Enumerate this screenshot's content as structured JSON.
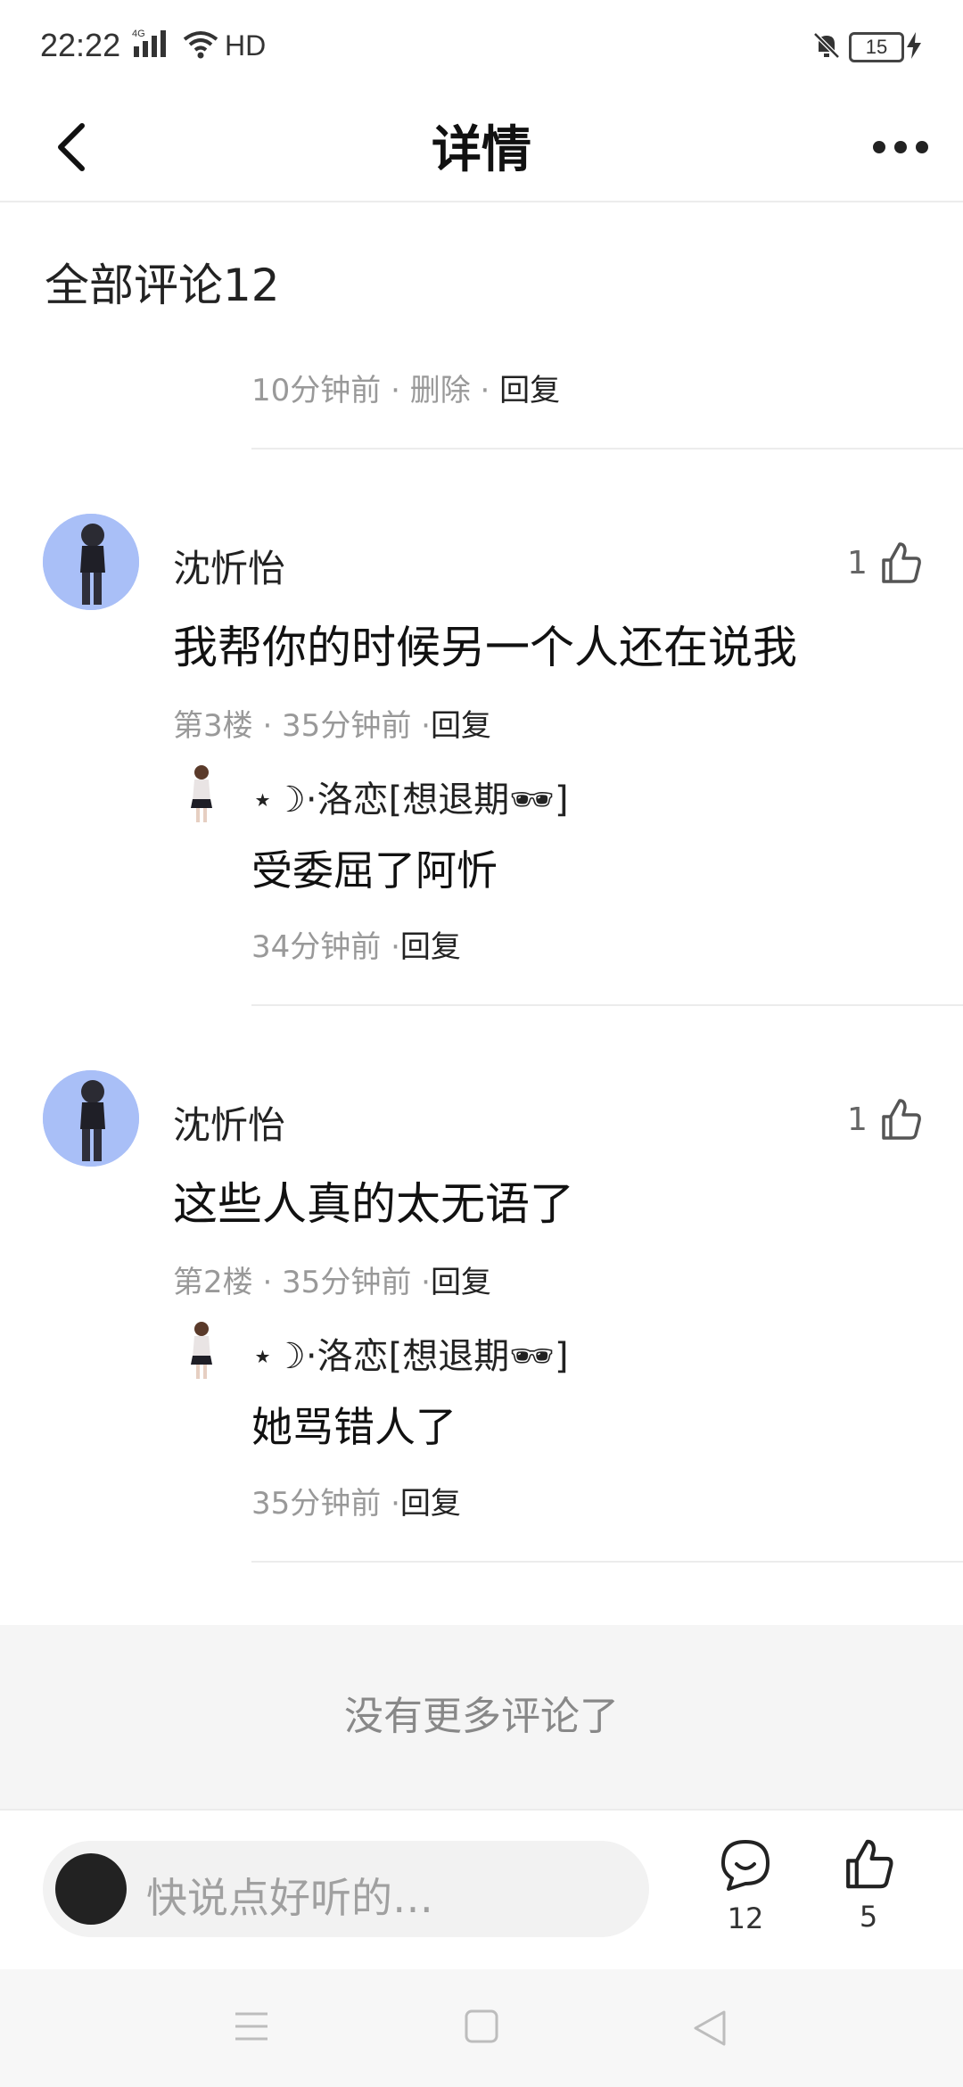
{
  "status_bar": {
    "time": "22:22",
    "network": "4G",
    "hd": "HD",
    "battery": "15"
  },
  "header": {
    "title": "详情"
  },
  "section": {
    "title": "全部评论12"
  },
  "top_partial": {
    "meta_time": "10分钟前",
    "sep1": " · ",
    "delete": "删除",
    "sep2": " · ",
    "reply": "回复"
  },
  "comments": [
    {
      "user": "沈忻怡",
      "likes": "1",
      "text": "我帮你的时候另一个人还在说我",
      "meta": "第3楼 · 35分钟前 ·",
      "reply_label": "回复",
      "sub": {
        "user": "⋆☽·洛恋[想退期🕶]",
        "text": "受委屈了阿忻",
        "meta": "34分钟前 ·",
        "reply_label": "回复"
      }
    },
    {
      "user": "沈忻怡",
      "likes": "1",
      "text": "这些人真的太无语了",
      "meta": "第2楼 · 35分钟前 ·",
      "reply_label": "回复",
      "sub": {
        "user": "⋆☽·洛恋[想退期🕶]",
        "text": "她骂错人了",
        "meta": "35分钟前 ·",
        "reply_label": "回复"
      }
    }
  ],
  "footer": {
    "no_more": "没有更多评论了"
  },
  "bottom_bar": {
    "input_placeholder": "快说点好听的…",
    "comment_count": "12",
    "like_count": "5"
  },
  "icons": {
    "back": "back-arrow-icon",
    "more": "more-icon",
    "like": "thumbs-up-icon",
    "comment": "comment-bubble-icon",
    "nav_menu": "menu-icon",
    "nav_home": "home-square-icon",
    "nav_back": "back-triangle-icon"
  }
}
